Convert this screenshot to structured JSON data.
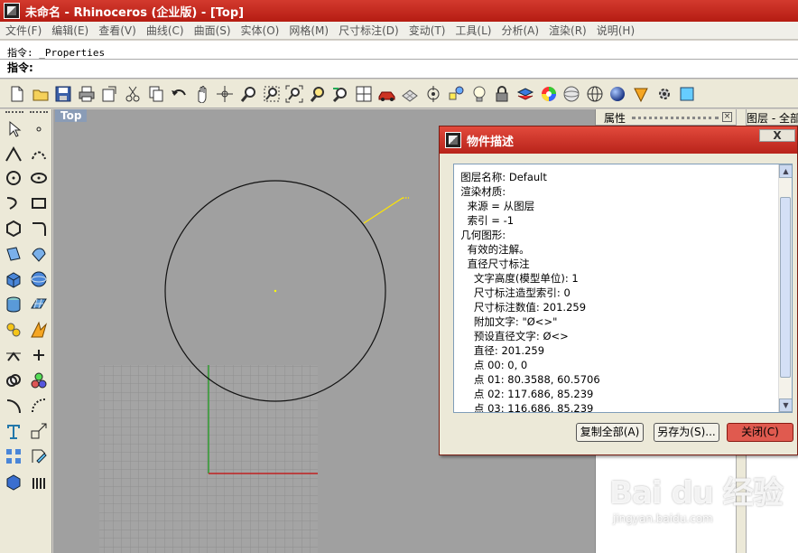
{
  "window": {
    "title": "未命名 - Rhinoceros (企业版) - [Top]"
  },
  "menubar": {
    "items": [
      "文件(F)",
      "编辑(E)",
      "查看(V)",
      "曲线(C)",
      "曲面(S)",
      "实体(O)",
      "网格(M)",
      "尺寸标注(D)",
      "变动(T)",
      "工具(L)",
      "分析(A)",
      "渲染(R)",
      "说明(H)"
    ]
  },
  "command": {
    "history": "指令: _Properties",
    "prompt": "指令:",
    "value": ""
  },
  "toolbar": {
    "icons": [
      "new-file-icon",
      "open-file-icon",
      "save-icon",
      "print-icon",
      "import-icon",
      "cut-icon",
      "copy-icon",
      "undo-icon",
      "pan-icon",
      "rotate-view-icon",
      "zoom-icon",
      "zoom-window-icon",
      "zoom-extents-icon",
      "zoom-selected-icon",
      "zoom-prev-icon",
      "four-viewports-icon",
      "car-icon",
      "plane-icon",
      "point-icon",
      "osnap-icon",
      "light-icon",
      "lock-icon",
      "layer-icon",
      "color-wheel-icon",
      "sphere-icon",
      "wire-sphere-icon",
      "render-sphere-icon",
      "cone-icon",
      "settings-icon",
      "more-icon"
    ]
  },
  "viewport": {
    "label": "Top",
    "background": "#a0a0a0"
  },
  "right_panel": {
    "tab1": "属性",
    "tab2": "图层 - 全部"
  },
  "dialog": {
    "title": "物件描述",
    "close_x": "X",
    "lines": [
      "  图层名称: Default",
      "  渲染材质:",
      "    来源 = 从图层",
      "    索引 = -1",
      "  几何图形:",
      "    有效的注解。",
      "    直径尺寸标注",
      "      文字高度(模型单位): 1",
      "      尺寸标注造型索引: 0",
      "      尺寸标注数值: 201.259",
      "      附加文字: \"Ø<>\"",
      "      预设直径文字: Ø<>",
      "      直径: 201.259",
      "      点 00: 0, 0",
      "      点 01: 80.3588, 60.5706",
      "      点 02: 117.686, 85.239",
      "      点 03: 116.686, 85.239"
    ],
    "buttons": {
      "copy_all": "复制全部(A)",
      "save_as": "另存为(S)...",
      "close": "关闭(C)"
    }
  },
  "watermark": {
    "logo": "Bai du 经验",
    "url": "jingyan.baidu.com"
  }
}
